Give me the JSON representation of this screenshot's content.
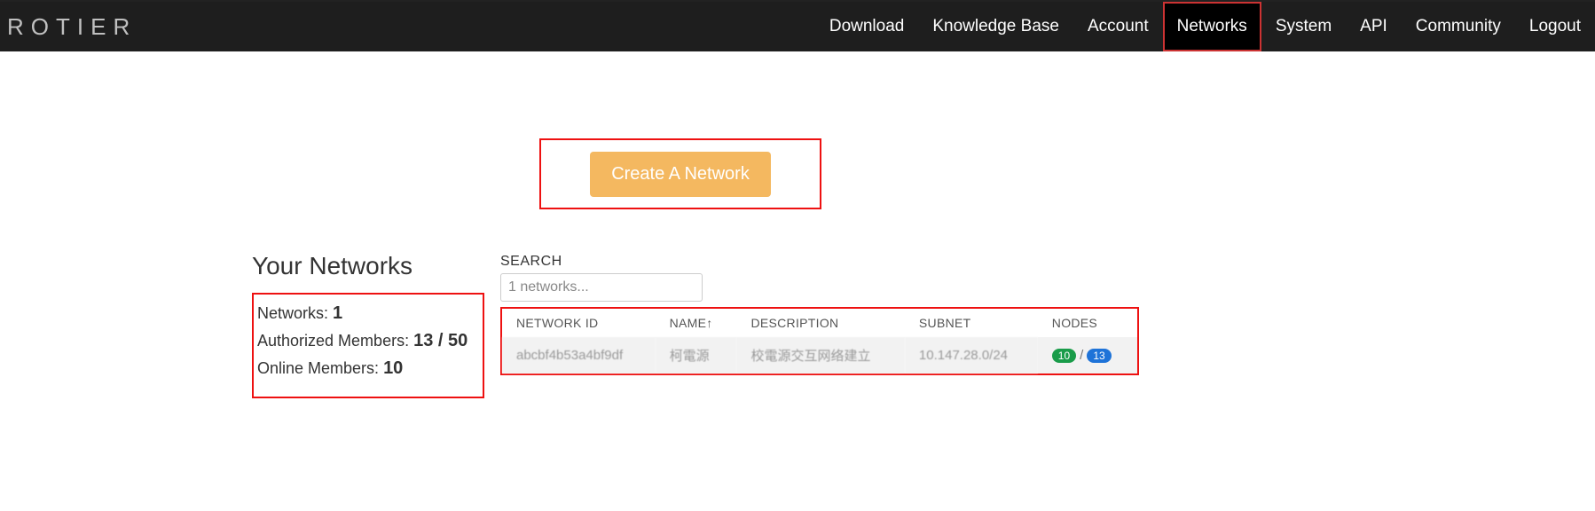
{
  "brand": "ROTIER",
  "nav": {
    "download": "Download",
    "knowledge_base": "Knowledge Base",
    "account": "Account",
    "networks": "Networks",
    "system": "System",
    "api": "API",
    "community": "Community",
    "logout": "Logout"
  },
  "create_button": "Create A Network",
  "page_title": "Your Networks",
  "stats": {
    "networks_label": "Networks: ",
    "networks_value": "1",
    "auth_label": "Authorized Members: ",
    "auth_value": "13 / 50",
    "online_label": "Online Members: ",
    "online_value": "10"
  },
  "search": {
    "label": "SEARCH",
    "placeholder": "1 networks..."
  },
  "table": {
    "headers": {
      "network_id": "NETWORK ID",
      "name": "NAME↑",
      "description": "DESCRIPTION",
      "subnet": "SUBNET",
      "nodes": "NODES"
    },
    "row": {
      "network_id": "abcbf4b53a4bf9df",
      "name": "柯電源",
      "description": "校電源交互网络建立",
      "subnet": "10.147.28.0/24",
      "nodes_green": "10",
      "nodes_slash": "/",
      "nodes_blue": "13"
    }
  }
}
